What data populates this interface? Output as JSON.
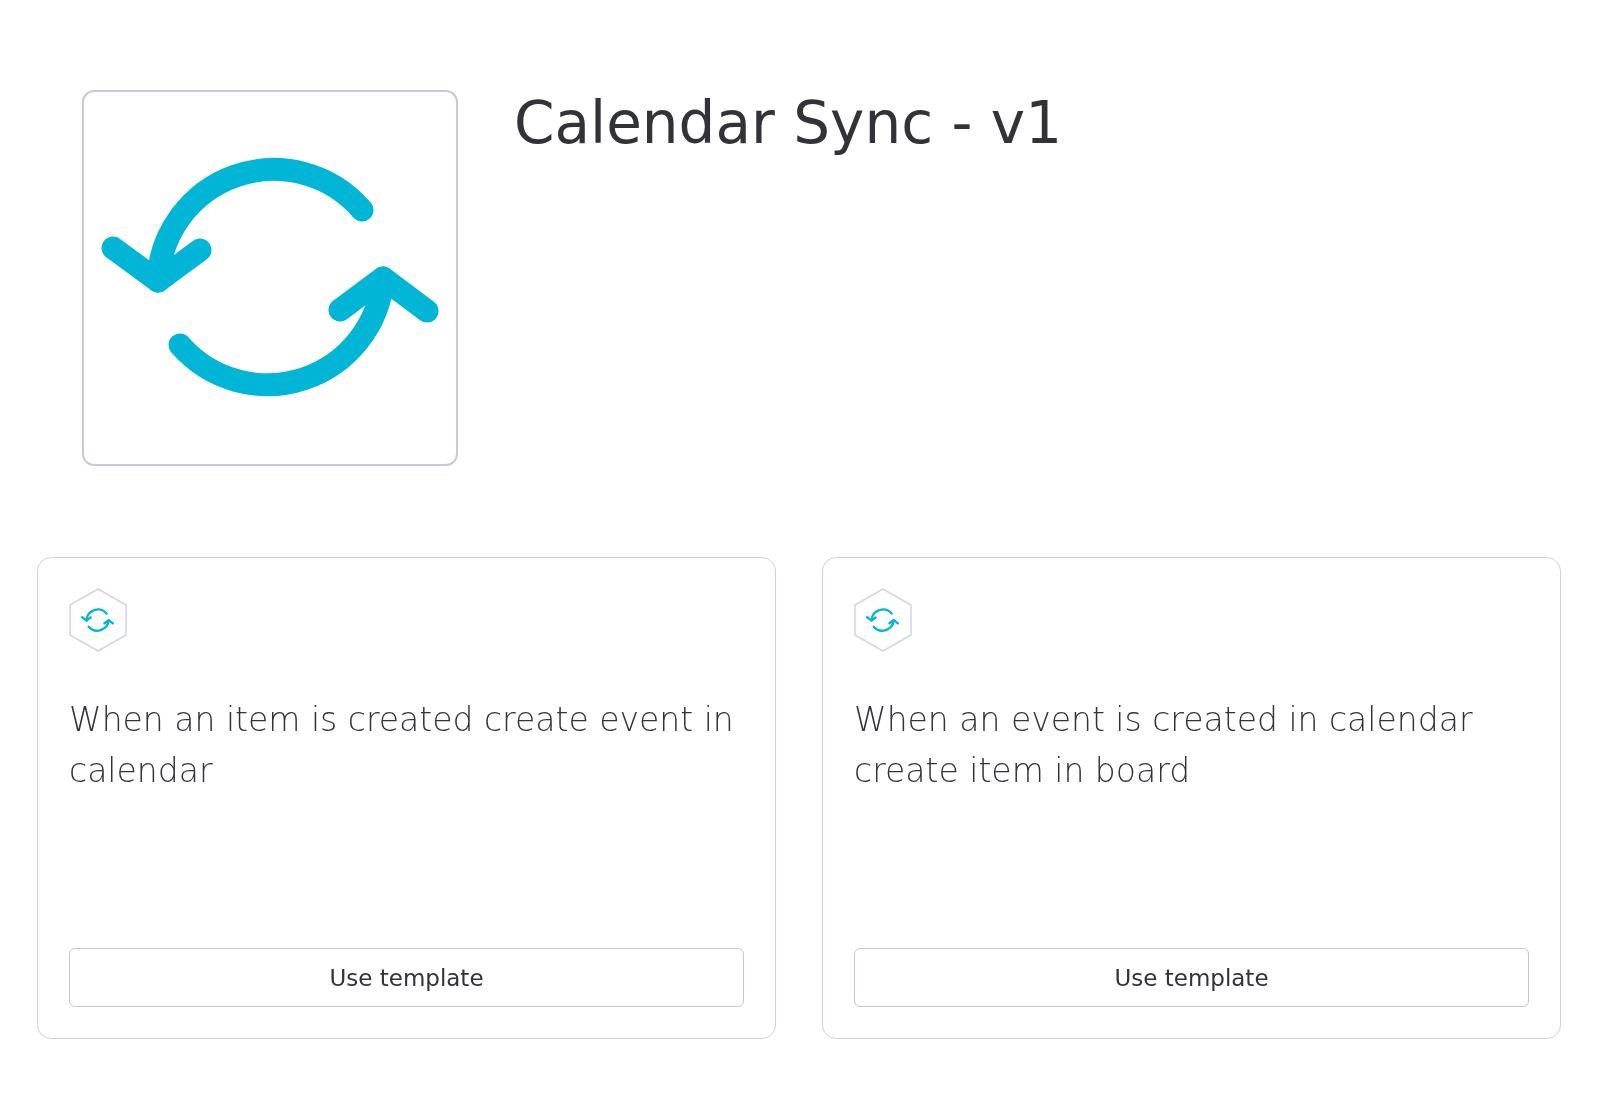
{
  "template": {
    "title": "Calendar Sync - v1"
  },
  "recipes": [
    {
      "text": "When an item is created create event in calendar",
      "button": "Use template"
    },
    {
      "text": "When an event is created in calendar create item in board",
      "button": "Use template"
    }
  ]
}
